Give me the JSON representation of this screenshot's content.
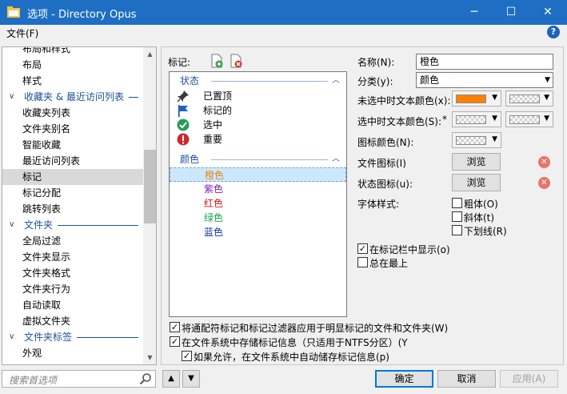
{
  "window": {
    "title": "选项 - Directory Opus",
    "minimize": "─",
    "maximize": "☐",
    "close": "✕"
  },
  "menu": {
    "file": "文件(F)"
  },
  "help_icon": "question-circle-icon",
  "tree": {
    "items": [
      {
        "label": "布局和样式",
        "type": "item"
      },
      {
        "label": "布局",
        "type": "item"
      },
      {
        "label": "样式",
        "type": "item"
      },
      {
        "label": "收藏夹 & 最近访问列表",
        "type": "header"
      },
      {
        "label": "收藏夹列表",
        "type": "item"
      },
      {
        "label": "文件夹别名",
        "type": "item"
      },
      {
        "label": "智能收藏",
        "type": "item"
      },
      {
        "label": "最近访问列表",
        "type": "item"
      },
      {
        "label": "标记",
        "type": "item",
        "selected": true
      },
      {
        "label": "标记分配",
        "type": "item"
      },
      {
        "label": "跳转列表",
        "type": "item"
      },
      {
        "label": "文件夹",
        "type": "header"
      },
      {
        "label": "全局过滤",
        "type": "item"
      },
      {
        "label": "文件夹显示",
        "type": "item"
      },
      {
        "label": "文件夹格式",
        "type": "item"
      },
      {
        "label": "文件夹行为",
        "type": "item"
      },
      {
        "label": "自动读取",
        "type": "item"
      },
      {
        "label": "虚拟文件夹",
        "type": "item"
      },
      {
        "label": "文件夹标签",
        "type": "header"
      },
      {
        "label": "外观",
        "type": "item"
      }
    ]
  },
  "search": {
    "placeholder": "搜索首选项"
  },
  "marks": {
    "label": "标记:",
    "add_icon": "add-label-icon",
    "delete_icon": "delete-label-icon",
    "state_header": "状态",
    "states": [
      {
        "label": "已置顶",
        "icon": "pin-icon"
      },
      {
        "label": "标记的",
        "icon": "flag-icon"
      },
      {
        "label": "选中",
        "icon": "check-circle-icon"
      },
      {
        "label": "重要",
        "icon": "exclamation-icon"
      }
    ],
    "color_header": "颜色",
    "colors": [
      {
        "label": "橙色",
        "color": "#e8830f",
        "selected": true
      },
      {
        "label": "紫色",
        "color": "#8a19b8"
      },
      {
        "label": "红色",
        "color": "#d4161c"
      },
      {
        "label": "绿色",
        "color": "#19a34a"
      },
      {
        "label": "蓝色",
        "color": "#1133aa"
      }
    ]
  },
  "form": {
    "name_label": "名称(N):",
    "name_value": "橙色",
    "category_label": "分类(y):",
    "category_value": "颜色",
    "unsel_color_label": "未选中时文本颜色(x):",
    "unsel_color_value": "#ff8000",
    "sel_color_label": "选中时文本颜色(S):",
    "sel_color_star": "*",
    "icon_color_label": "图标颜色(N):",
    "file_icon_label": "文件图标(I)",
    "status_icon_label": "状态图标(u):",
    "browse": "浏览",
    "font_style_label": "字体样式:",
    "bold": "粗体(O)",
    "italic": "斜体(t)",
    "underline": "下划线(R)",
    "show_in_bar": "在标记栏中显示(o)",
    "show_in_bar_checked": true,
    "always_top": "总在最上",
    "always_top_checked": false
  },
  "bottom_checks": [
    {
      "label": "将通配符标记和标记过滤器应用于明显标记的文件和文件夹(W)",
      "checked": true
    },
    {
      "label": "在文件系统中存储标记信息（只适用于NTFS分区）(Y",
      "checked": true
    },
    {
      "label": "如果允许，在文件系统中自动储存标记信息(p)",
      "checked": true
    }
  ],
  "buttons": {
    "ok": "确定",
    "cancel": "取消",
    "apply": "应用(A)"
  }
}
